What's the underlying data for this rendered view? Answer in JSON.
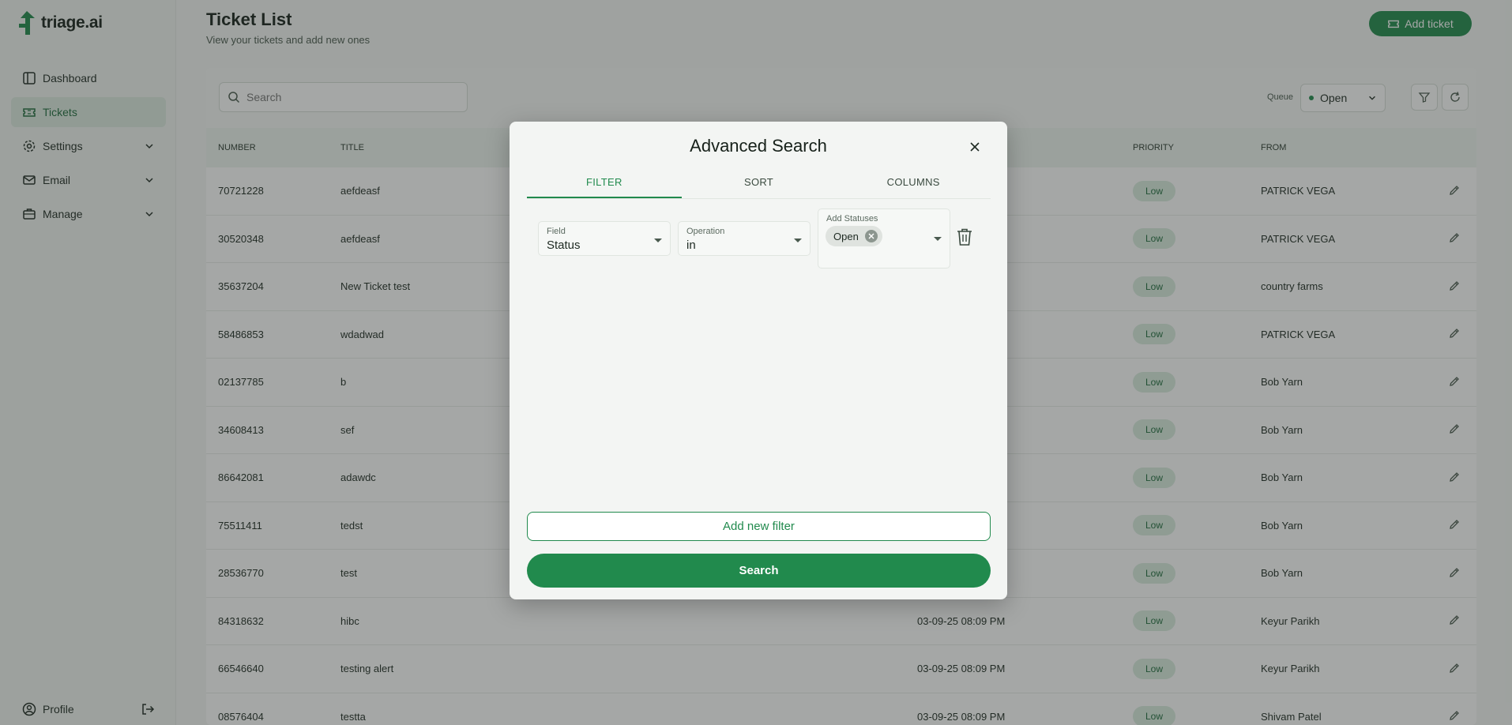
{
  "app": {
    "name": "triage.ai"
  },
  "sidebar": {
    "items": [
      {
        "label": "Dashboard",
        "icon": "dashboard-icon"
      },
      {
        "label": "Tickets",
        "icon": "ticket-icon",
        "active": true
      },
      {
        "label": "Settings",
        "icon": "gear-icon",
        "expandable": true
      },
      {
        "label": "Email",
        "icon": "mail-icon",
        "expandable": true
      },
      {
        "label": "Manage",
        "icon": "briefcase-icon",
        "expandable": true
      }
    ],
    "profile_label": "Profile"
  },
  "header": {
    "title": "Ticket List",
    "subtitle": "View your tickets and add new ones",
    "add_ticket_label": "Add ticket"
  },
  "toolbar": {
    "search_placeholder": "Search",
    "queue_label": "Queue",
    "queue_value": "Open"
  },
  "table": {
    "columns": [
      "NUMBER",
      "TITLE",
      "PRIORITY",
      "FROM"
    ],
    "rows": [
      {
        "number": "70721228",
        "title": "aefdeasf",
        "date": "",
        "priority": "Low",
        "from": "PATRICK VEGA"
      },
      {
        "number": "30520348",
        "title": "aefdeasf",
        "date": "",
        "priority": "Low",
        "from": "PATRICK VEGA"
      },
      {
        "number": "35637204",
        "title": "New Ticket test",
        "date": "",
        "priority": "Low",
        "from": "country farms"
      },
      {
        "number": "58486853",
        "title": "wdadwad",
        "date": "",
        "priority": "Low",
        "from": "PATRICK VEGA"
      },
      {
        "number": "02137785",
        "title": "b",
        "date": "",
        "priority": "Low",
        "from": "Bob Yarn"
      },
      {
        "number": "34608413",
        "title": "sef",
        "date": "",
        "priority": "Low",
        "from": "Bob Yarn"
      },
      {
        "number": "86642081",
        "title": "adawdc",
        "date": "",
        "priority": "Low",
        "from": "Bob Yarn"
      },
      {
        "number": "75511411",
        "title": "tedst",
        "date": "",
        "priority": "Low",
        "from": "Bob Yarn"
      },
      {
        "number": "28536770",
        "title": "test",
        "date": "",
        "priority": "Low",
        "from": "Bob Yarn"
      },
      {
        "number": "84318632",
        "title": "hibc",
        "date": "03-09-25 08:09 PM",
        "priority": "Low",
        "from": "Keyur Parikh"
      },
      {
        "number": "66546640",
        "title": "testing alert",
        "date": "03-09-25 08:09 PM",
        "priority": "Low",
        "from": "Keyur Parikh"
      },
      {
        "number": "08576404",
        "title": "testta",
        "date": "03-09-25 08:09 PM",
        "priority": "Low",
        "from": "Shivam Patel"
      }
    ]
  },
  "modal": {
    "title": "Advanced Search",
    "tabs": [
      {
        "label": "FILTER",
        "active": true
      },
      {
        "label": "SORT"
      },
      {
        "label": "COLUMNS"
      }
    ],
    "filter": {
      "field_label": "Field",
      "field_value": "Status",
      "operation_label": "Operation",
      "operation_value": "in",
      "statuses_label": "Add Statuses",
      "status_chip": "Open"
    },
    "add_filter_label": "Add new filter",
    "search_label": "Search"
  },
  "colors": {
    "accent": "#218a4d",
    "badge_bg": "#d9ecdf",
    "badge_text": "#1f6b3d"
  }
}
